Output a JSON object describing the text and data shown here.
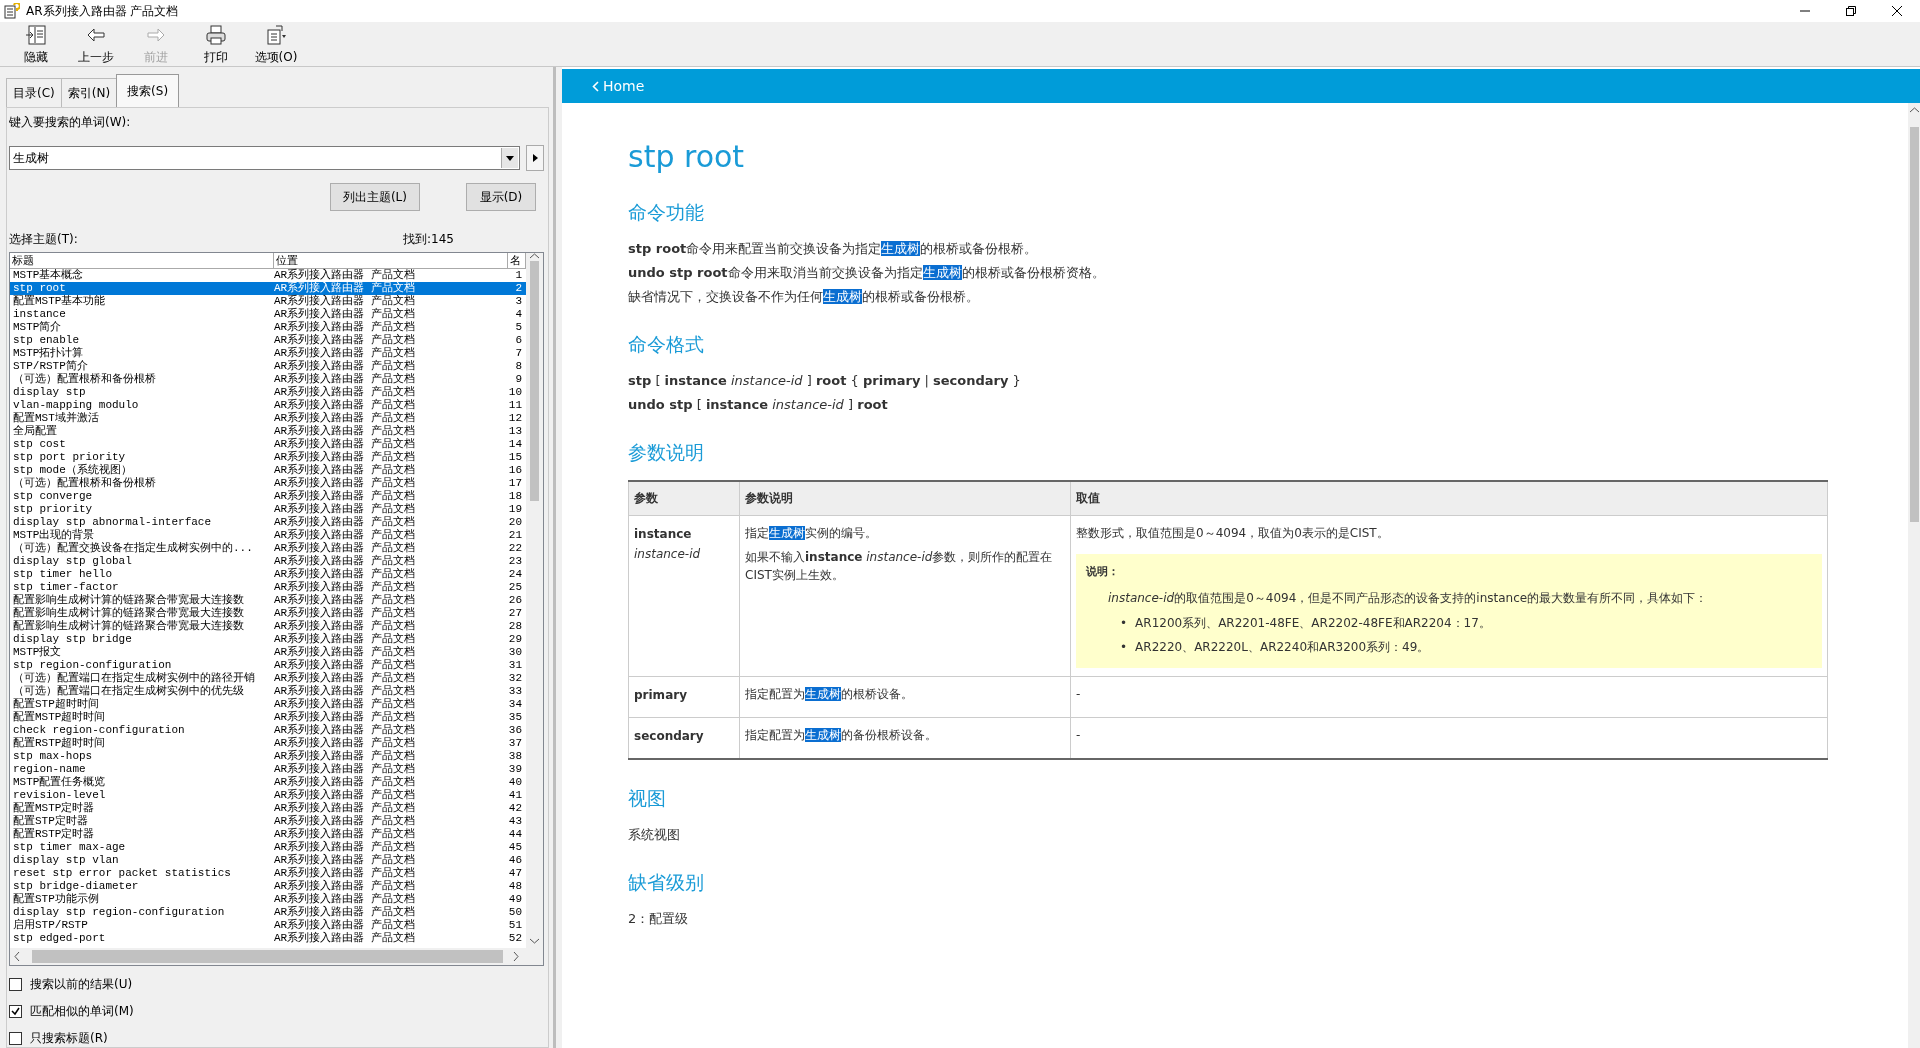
{
  "window": {
    "title": "AR系列接入路由器 产品文档"
  },
  "toolbar": [
    {
      "label": "隐藏",
      "disabled": false
    },
    {
      "label": "上一步",
      "disabled": false
    },
    {
      "label": "前进",
      "disabled": true
    },
    {
      "label": "打印",
      "disabled": false
    },
    {
      "label": "选项(O)",
      "disabled": false
    }
  ],
  "tabs": [
    {
      "label": "目录(C)",
      "selected": false
    },
    {
      "label": "索引(N)",
      "selected": false
    },
    {
      "label": "搜索(S)",
      "selected": true
    }
  ],
  "search": {
    "label": "键入要搜索的单词(W):",
    "value": "生成树",
    "list_button": "列出主题(L)",
    "display_button": "显示(D)",
    "topics_label": "选择主题(T):",
    "found": "找到:145"
  },
  "results": {
    "columns": [
      "标题",
      "位置",
      "名"
    ],
    "rows": [
      {
        "title": "MSTP基本概念",
        "location": "AR系列接入路由器 产品文档",
        "rank": "1",
        "selected": false
      },
      {
        "title": "stp root",
        "location": "AR系列接入路由器 产品文档",
        "rank": "2",
        "selected": true
      },
      {
        "title": "配置MSTP基本功能",
        "location": "AR系列接入路由器 产品文档",
        "rank": "3",
        "selected": false
      },
      {
        "title": "instance",
        "location": "AR系列接入路由器 产品文档",
        "rank": "4",
        "selected": false
      },
      {
        "title": "MSTP简介",
        "location": "AR系列接入路由器 产品文档",
        "rank": "5",
        "selected": false
      },
      {
        "title": "stp enable",
        "location": "AR系列接入路由器 产品文档",
        "rank": "6",
        "selected": false
      },
      {
        "title": "MSTP拓扑计算",
        "location": "AR系列接入路由器 产品文档",
        "rank": "7",
        "selected": false
      },
      {
        "title": "STP/RSTP简介",
        "location": "AR系列接入路由器 产品文档",
        "rank": "8",
        "selected": false
      },
      {
        "title": "（可选）配置根桥和备份根桥",
        "location": "AR系列接入路由器 产品文档",
        "rank": "9",
        "selected": false
      },
      {
        "title": "display stp",
        "location": "AR系列接入路由器 产品文档",
        "rank": "10",
        "selected": false
      },
      {
        "title": "vlan-mapping modulo",
        "location": "AR系列接入路由器 产品文档",
        "rank": "11",
        "selected": false
      },
      {
        "title": "配置MST域并激活",
        "location": "AR系列接入路由器 产品文档",
        "rank": "12",
        "selected": false
      },
      {
        "title": "全局配置",
        "location": "AR系列接入路由器 产品文档",
        "rank": "13",
        "selected": false
      },
      {
        "title": "stp cost",
        "location": "AR系列接入路由器 产品文档",
        "rank": "14",
        "selected": false
      },
      {
        "title": "stp port priority",
        "location": "AR系列接入路由器 产品文档",
        "rank": "15",
        "selected": false
      },
      {
        "title": "stp mode（系统视图）",
        "location": "AR系列接入路由器 产品文档",
        "rank": "16",
        "selected": false
      },
      {
        "title": "（可选）配置根桥和备份根桥",
        "location": "AR系列接入路由器 产品文档",
        "rank": "17",
        "selected": false
      },
      {
        "title": "stp converge",
        "location": "AR系列接入路由器 产品文档",
        "rank": "18",
        "selected": false
      },
      {
        "title": "stp priority",
        "location": "AR系列接入路由器 产品文档",
        "rank": "19",
        "selected": false
      },
      {
        "title": "display stp abnormal-interface",
        "location": "AR系列接入路由器 产品文档",
        "rank": "20",
        "selected": false
      },
      {
        "title": "MSTP出现的背景",
        "location": "AR系列接入路由器 产品文档",
        "rank": "21",
        "selected": false
      },
      {
        "title": "（可选）配置交换设备在指定生成树实例中的...",
        "location": "AR系列接入路由器 产品文档",
        "rank": "22",
        "selected": false
      },
      {
        "title": "display stp global",
        "location": "AR系列接入路由器 产品文档",
        "rank": "23",
        "selected": false
      },
      {
        "title": "stp timer hello",
        "location": "AR系列接入路由器 产品文档",
        "rank": "24",
        "selected": false
      },
      {
        "title": "stp timer-factor",
        "location": "AR系列接入路由器 产品文档",
        "rank": "25",
        "selected": false
      },
      {
        "title": "配置影响生成树计算的链路聚合带宽最大连接数",
        "location": "AR系列接入路由器 产品文档",
        "rank": "26",
        "selected": false
      },
      {
        "title": "配置影响生成树计算的链路聚合带宽最大连接数",
        "location": "AR系列接入路由器 产品文档",
        "rank": "27",
        "selected": false
      },
      {
        "title": "配置影响生成树计算的链路聚合带宽最大连接数",
        "location": "AR系列接入路由器 产品文档",
        "rank": "28",
        "selected": false
      },
      {
        "title": "display stp bridge",
        "location": "AR系列接入路由器 产品文档",
        "rank": "29",
        "selected": false
      },
      {
        "title": "MSTP报文",
        "location": "AR系列接入路由器 产品文档",
        "rank": "30",
        "selected": false
      },
      {
        "title": "stp region-configuration",
        "location": "AR系列接入路由器 产品文档",
        "rank": "31",
        "selected": false
      },
      {
        "title": "（可选）配置端口在指定生成树实例中的路径开销",
        "location": "AR系列接入路由器 产品文档",
        "rank": "32",
        "selected": false
      },
      {
        "title": "（可选）配置端口在指定生成树实例中的优先级",
        "location": "AR系列接入路由器 产品文档",
        "rank": "33",
        "selected": false
      },
      {
        "title": "配置STP超时时间",
        "location": "AR系列接入路由器 产品文档",
        "rank": "34",
        "selected": false
      },
      {
        "title": "配置MSTP超时时间",
        "location": "AR系列接入路由器 产品文档",
        "rank": "35",
        "selected": false
      },
      {
        "title": "check region-configuration",
        "location": "AR系列接入路由器 产品文档",
        "rank": "36",
        "selected": false
      },
      {
        "title": "配置RSTP超时时间",
        "location": "AR系列接入路由器 产品文档",
        "rank": "37",
        "selected": false
      },
      {
        "title": "stp max-hops",
        "location": "AR系列接入路由器 产品文档",
        "rank": "38",
        "selected": false
      },
      {
        "title": "region-name",
        "location": "AR系列接入路由器 产品文档",
        "rank": "39",
        "selected": false
      },
      {
        "title": "MSTP配置任务概览",
        "location": "AR系列接入路由器 产品文档",
        "rank": "40",
        "selected": false
      },
      {
        "title": "revision-level",
        "location": "AR系列接入路由器 产品文档",
        "rank": "41",
        "selected": false
      },
      {
        "title": "配置MSTP定时器",
        "location": "AR系列接入路由器 产品文档",
        "rank": "42",
        "selected": false
      },
      {
        "title": "配置STP定时器",
        "location": "AR系列接入路由器 产品文档",
        "rank": "43",
        "selected": false
      },
      {
        "title": "配置RSTP定时器",
        "location": "AR系列接入路由器 产品文档",
        "rank": "44",
        "selected": false
      },
      {
        "title": "stp timer max-age",
        "location": "AR系列接入路由器 产品文档",
        "rank": "45",
        "selected": false
      },
      {
        "title": "display stp vlan",
        "location": "AR系列接入路由器 产品文档",
        "rank": "46",
        "selected": false
      },
      {
        "title": "reset stp error packet statistics",
        "location": "AR系列接入路由器 产品文档",
        "rank": "47",
        "selected": false
      },
      {
        "title": "stp bridge-diameter",
        "location": "AR系列接入路由器 产品文档",
        "rank": "48",
        "selected": false
      },
      {
        "title": "配置STP功能示例",
        "location": "AR系列接入路由器 产品文档",
        "rank": "49",
        "selected": false
      },
      {
        "title": "display stp region-configuration",
        "location": "AR系列接入路由器 产品文档",
        "rank": "50",
        "selected": false
      },
      {
        "title": "启用STP/RSTP",
        "location": "AR系列接入路由器 产品文档",
        "rank": "51",
        "selected": false
      },
      {
        "title": "stp edged-port",
        "location": "AR系列接入路由器 产品文档",
        "rank": "52",
        "selected": false
      }
    ]
  },
  "options": [
    {
      "label": "搜索以前的结果(U)",
      "checked": false
    },
    {
      "label": "匹配相似的单词(M)",
      "checked": true
    },
    {
      "label": "只搜索标题(R)",
      "checked": false
    }
  ],
  "content": {
    "nav": "Home",
    "title": "stp root",
    "sections": [
      {
        "kind": "lines",
        "heading": "命令功能",
        "lines": [
          [
            {
              "kind": "text",
              "text": "**stp root**命令用来配置当前交换设备为指定"
            },
            {
              "kind": "match",
              "text": "生成树"
            },
            {
              "kind": "text",
              "text": "的根桥或备份根桥。"
            }
          ],
          [
            {
              "kind": "text",
              "text": "**undo stp root**命令用来取消当前交换设备为指定"
            },
            {
              "kind": "match",
              "text": "生成树"
            },
            {
              "kind": "text",
              "text": "的根桥或备份根桥资格。"
            }
          ],
          [
            {
              "kind": "text",
              "text": "缺省情况下，交换设备不作为任何"
            },
            {
              "kind": "match",
              "text": "生成树"
            },
            {
              "kind": "text",
              "text": "的根桥或备份根桥。"
            }
          ]
        ]
      },
      {
        "kind": "lines",
        "heading": "命令格式",
        "lines": [
          [
            {
              "kind": "text",
              "text": "**stp** [ **instance** *instance-id* ] **root** { **primary** | **secondary** }"
            }
          ],
          [
            {
              "kind": "text",
              "text": "**undo stp** [ **instance** *instance-id* ] **root**"
            }
          ]
        ]
      },
      {
        "kind": "table",
        "heading": "参数说明",
        "columns": [
          "参数",
          "参数说明",
          "取值"
        ],
        "rows": [
          {
            "param": "**instance** *instance-id*",
            "description": [
              [
                {
                  "kind": "text",
                  "text": "指定"
                },
                {
                  "kind": "match",
                  "text": "生成树"
                },
                {
                  "kind": "text",
                  "text": "实例的编号。"
                }
              ],
              [
                {
                  "kind": "text",
                  "text": "如果不输入**instance** *instance-id*"
                },
                {
                  "kind": "text",
                  "text": "参数，则所作的配置在CIST实例上生效。"
                }
              ]
            ],
            "value": "整数形式，取值范围是0～4094，取值为0表示的是CIST。",
            "note": {
              "title": "说明：",
              "text": [
                {
                  "kind": "text",
                  "text": "*instance-id*"
                },
                {
                  "kind": "text",
                  "text": "的取值范围是0～4094，但是不同产品形态的设备支持的instance的最大数量有所不同，具体如下："
                }
              ],
              "bullets": [
                {
                  "marker": "•",
                  "text": "AR1200系列、AR2201-48FE、AR2202-48FE和AR2204：17。"
                },
                {
                  "marker": "•",
                  "text": "AR2220、AR2220L、AR2240和AR3200系列：49。"
                }
              ]
            }
          },
          {
            "param": "**primary**",
            "description": [
              [
                {
                  "kind": "text",
                  "text": "指定配置为"
                },
                {
                  "kind": "match",
                  "text": "生成树"
                },
                {
                  "kind": "text",
                  "text": "的根桥设备。"
                }
              ]
            ],
            "value": "-"
          },
          {
            "param": "**secondary**",
            "description": [
              [
                {
                  "kind": "text",
                  "text": "指定配置为"
                },
                {
                  "kind": "match",
                  "text": "生成树"
                },
                {
                  "kind": "text",
                  "text": "的备份根桥设备。"
                }
              ]
            ],
            "value": "-"
          }
        ]
      },
      {
        "kind": "text",
        "heading": "视图",
        "text": "系统视图"
      },
      {
        "kind": "text",
        "heading": "缺省级别",
        "text": "2：配置级"
      }
    ]
  }
}
